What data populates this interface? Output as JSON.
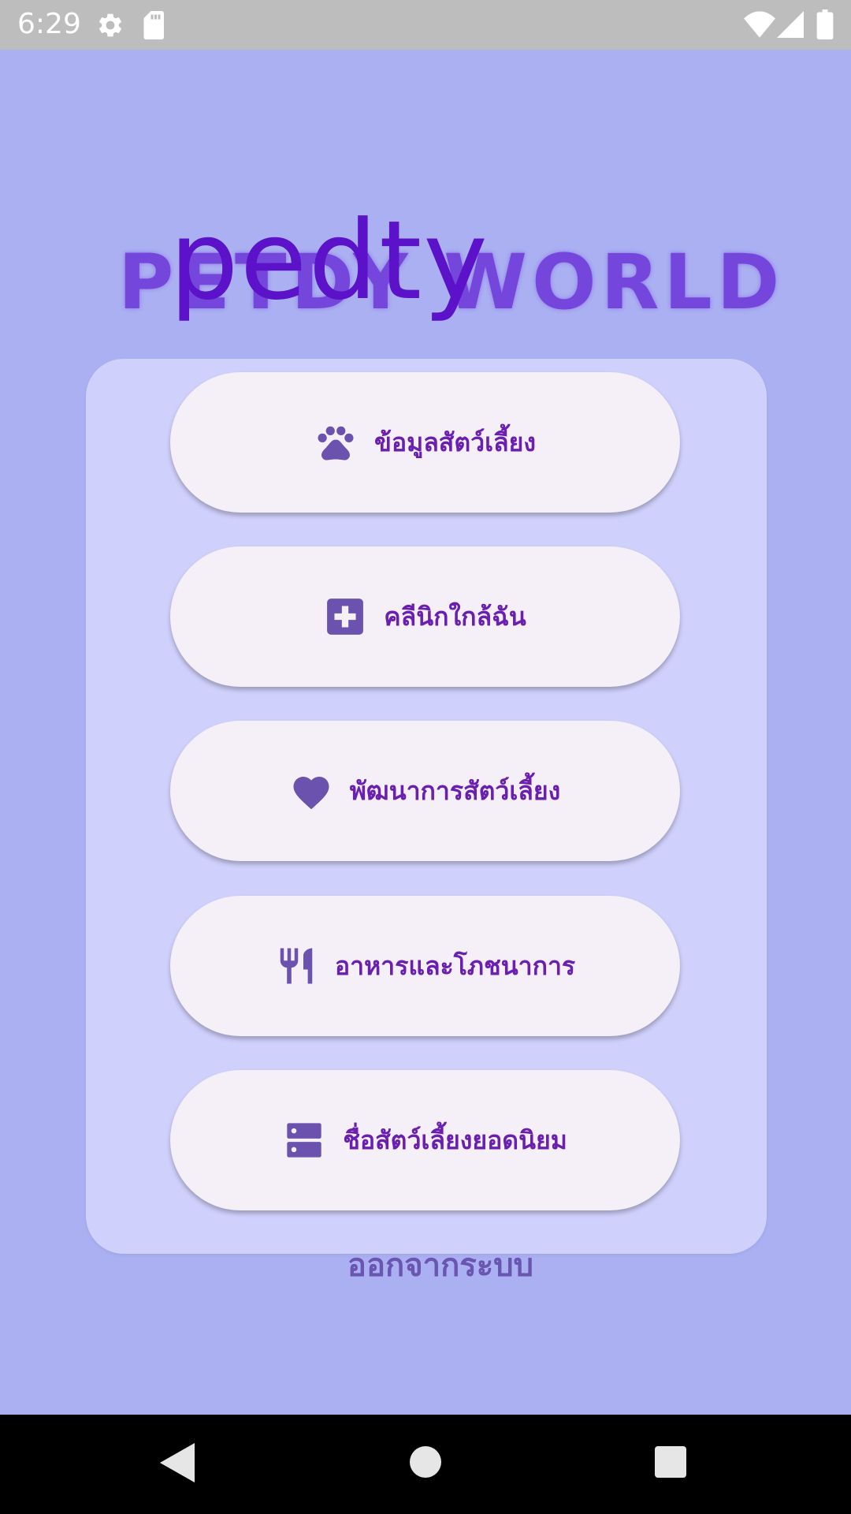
{
  "status_bar": {
    "time": "6:29",
    "icons": [
      "settings-icon",
      "sd-card-icon",
      "wifi-icon",
      "signal-icon",
      "battery-icon"
    ]
  },
  "logo": {
    "back_text": "PETDY WORLD",
    "front_text": "pedty"
  },
  "menu": {
    "items": [
      {
        "label": "ข้อมูลสัตว์เลี้ยง",
        "icon": "paw-icon"
      },
      {
        "label": "คลีนิกใกล้ฉัน",
        "icon": "medical-plus-icon"
      },
      {
        "label": "พัฒนาการสัตว์เลี้ยง",
        "icon": "heart-icon"
      },
      {
        "label": "อาหารและโภชนาการ",
        "icon": "fork-knife-icon"
      },
      {
        "label": "ชื่อสัตว์เลี้ยงยอดนิยม",
        "icon": "storage-icon"
      }
    ]
  },
  "logout": {
    "label": "ออกจากระบบ"
  },
  "nav": {
    "icons": [
      "back-icon",
      "home-icon",
      "recents-icon"
    ]
  },
  "colors": {
    "background": "#aab0f2",
    "card": "#d0d0fc",
    "button": "#f5eff8",
    "accent_text": "#6a1fb0",
    "icon": "#6a52ae"
  }
}
